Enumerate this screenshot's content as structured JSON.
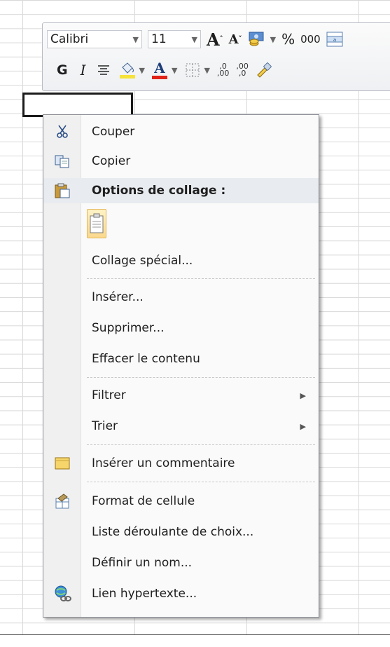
{
  "toolbar": {
    "font_name": "Calibri",
    "font_size": "11",
    "grow_font": "A",
    "shrink_font": "A",
    "percent": "%",
    "thousands": "000",
    "bold": "G",
    "italic": "I",
    "inc_decimal_top": ",0",
    "inc_decimal_bottom": ",00",
    "dec_decimal_top": ",00",
    "dec_decimal_bottom": ",0",
    "fill_color": "#f5e23a",
    "font_color": "#e0241a"
  },
  "menu": {
    "items": [
      {
        "label": "Couper",
        "icon": "scissors-icon"
      },
      {
        "label": "Copier",
        "icon": "copy-icon"
      },
      {
        "label": "Options de collage :",
        "icon": "paste-icon"
      },
      {
        "label": "Collage spécial..."
      },
      {
        "label": "Insérer..."
      },
      {
        "label": "Supprimer..."
      },
      {
        "label": "Effacer le contenu"
      },
      {
        "label": "Filtrer",
        "submenu": true
      },
      {
        "label": "Trier",
        "submenu": true
      },
      {
        "label": "Insérer un commentaire",
        "icon": "comment-icon"
      },
      {
        "label": "Format de cellule",
        "icon": "format-cells-icon"
      },
      {
        "label": "Liste déroulante de choix..."
      },
      {
        "label": "Définir un nom..."
      },
      {
        "label": "Lien hypertexte...",
        "icon": "hyperlink-icon"
      }
    ]
  }
}
